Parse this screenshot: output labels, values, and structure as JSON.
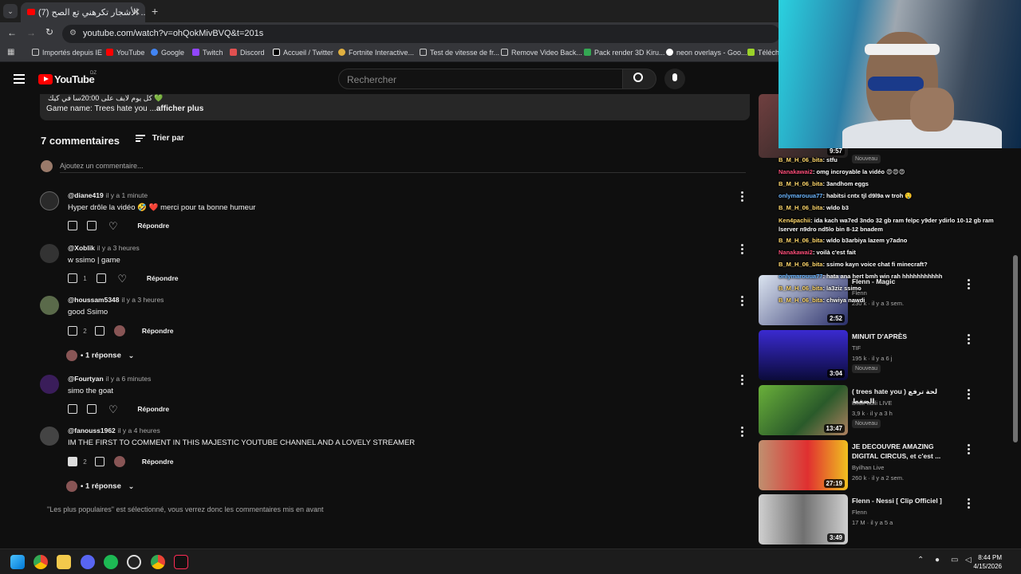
{
  "browser": {
    "tab_title": "(7) الأشجار تكرهني تع الصح ...",
    "url": "youtube.com/watch?v=ohQokMivBVQ&t=201s",
    "bookmarks": [
      "Importés depuis IE",
      "YouTube",
      "Google",
      "Twitch",
      "Discord",
      "Accueil / Twitter",
      "Fortnite Interactive...",
      "Test de vitesse de fr...",
      "Remove Video Back...",
      "Pack render 3D Kiru...",
      "neon overlays - Goo...",
      "Télécha"
    ]
  },
  "youtube": {
    "logo_text": "YouTube",
    "region": "DZ",
    "search_placeholder": "Rechercher"
  },
  "description": {
    "arabic_line": "كل يوم لايف على 20:00سا في كيك 💚",
    "game_line": "Game name: Trees hate you ...",
    "more": "afficher plus"
  },
  "comments_header": {
    "count": "7 commentaires",
    "sort": "Trier par",
    "add_placeholder": "Ajoutez un commentaire..."
  },
  "comments": [
    {
      "handle": "@diane419",
      "time": "il y a 1 minute",
      "text": "Hyper drôle la vidéo 🤣 ❤️ merci pour ta bonne humeur",
      "likes": "",
      "reply": "Répondre"
    },
    {
      "handle": "@Xoblik",
      "time": "il y a 3 heures",
      "text": "w ssimo | game",
      "likes": "1",
      "reply": "Répondre"
    },
    {
      "handle": "@houssam5348",
      "time": "il y a 3 heures",
      "text": "good Ssimo",
      "likes": "2",
      "reply": "Répondre",
      "replies": "1 réponse"
    },
    {
      "handle": "@Fourtyan",
      "time": "il y a 6 minutes",
      "text": "simo the goat",
      "likes": "",
      "reply": "Répondre"
    },
    {
      "handle": "@fanouss1962",
      "time": "il y a 4 heures",
      "text": "IM THE FIRST TO COMMENT IN THIS MAJESTIC YOUTUBE CHANNEL AND A LOVELY STREAMER",
      "likes": "2",
      "reply": "Répondre",
      "replies": "1 réponse"
    }
  ],
  "footer_note": "\"Les plus populaires\" est sélectionné, vous verrez donc les commentaires mis en avant",
  "related": [
    {
      "title": "Flenn - Magic",
      "channel": "Flenn",
      "meta": "230 k · il y a 3 sem.",
      "duration": "2:52",
      "badge": ""
    },
    {
      "title": "MINUIT D'APRÈS",
      "channel": "TIF",
      "meta": "195 k · il y a 6 j",
      "duration": "3:04",
      "badge": "Nouveau"
    },
    {
      "title": "( trees hate you ) لحة ترفع الضغط",
      "channel": "BilalFadili LIVE",
      "meta": "3,9 k · il y a 3 h",
      "duration": "13:47",
      "badge": "Nouveau"
    },
    {
      "title": "JE DECOUVRE AMAZING DIGITAL CIRCUS, et c'est ...",
      "channel": "Byilhan Live",
      "meta": "260 k · il y a 2 sem.",
      "duration": "27:19",
      "badge": ""
    },
    {
      "title": "Flenn - Nessi [ Clip Officiel ]",
      "channel": "Flenn",
      "meta": "17 M · il y a 5 a",
      "duration": "3:49",
      "badge": ""
    }
  ],
  "top_partial": {
    "duration": "9:57",
    "badge": "Nouveau"
  },
  "chat": [
    {
      "user": "B_M_H_06_bita",
      "msg": ": stfu"
    },
    {
      "user": "Nanakawai2",
      "msg": ": omg incroyable la vidéo 😍😍😍"
    },
    {
      "user": "B_M_H_06_bita",
      "msg": ": 3andhom eggs"
    },
    {
      "user": "onlymarouua77",
      "msg": ": habitsi cntx tjl d9l9a w troh 🤤"
    },
    {
      "user": "B_M_H_06_bita",
      "msg": ": wldo b3"
    },
    {
      "user": "Ken4pachii",
      "msg": ": ida kach wa7ed 3ndo 32 gb ram felpc y9der ydirlo 10-12 gb ram lserver n9dro nd5lo bin 8-12 bnadem"
    },
    {
      "user": "B_M_H_06_bita",
      "msg": ": wldo b3arbiya lazem y7adno"
    },
    {
      "user": "Nanakawai2",
      "msg": ": voilà c'est fait"
    },
    {
      "user": "B_M_H_06_bita",
      "msg": ": ssimo kayn voice chat fi minecraft?"
    },
    {
      "user": "onlymarouua77",
      "msg": ": hata ana hert bmh win rah hhhhhhhhhhh"
    },
    {
      "user": "B_M_H_06_bita",
      "msg": ": la3ziz ssimo"
    },
    {
      "user": "B_M_H_06_bita",
      "msg": ": chwiya nawdi"
    }
  ],
  "taskbar": {
    "time": "8:44 PM",
    "date": "4/15/2026"
  }
}
